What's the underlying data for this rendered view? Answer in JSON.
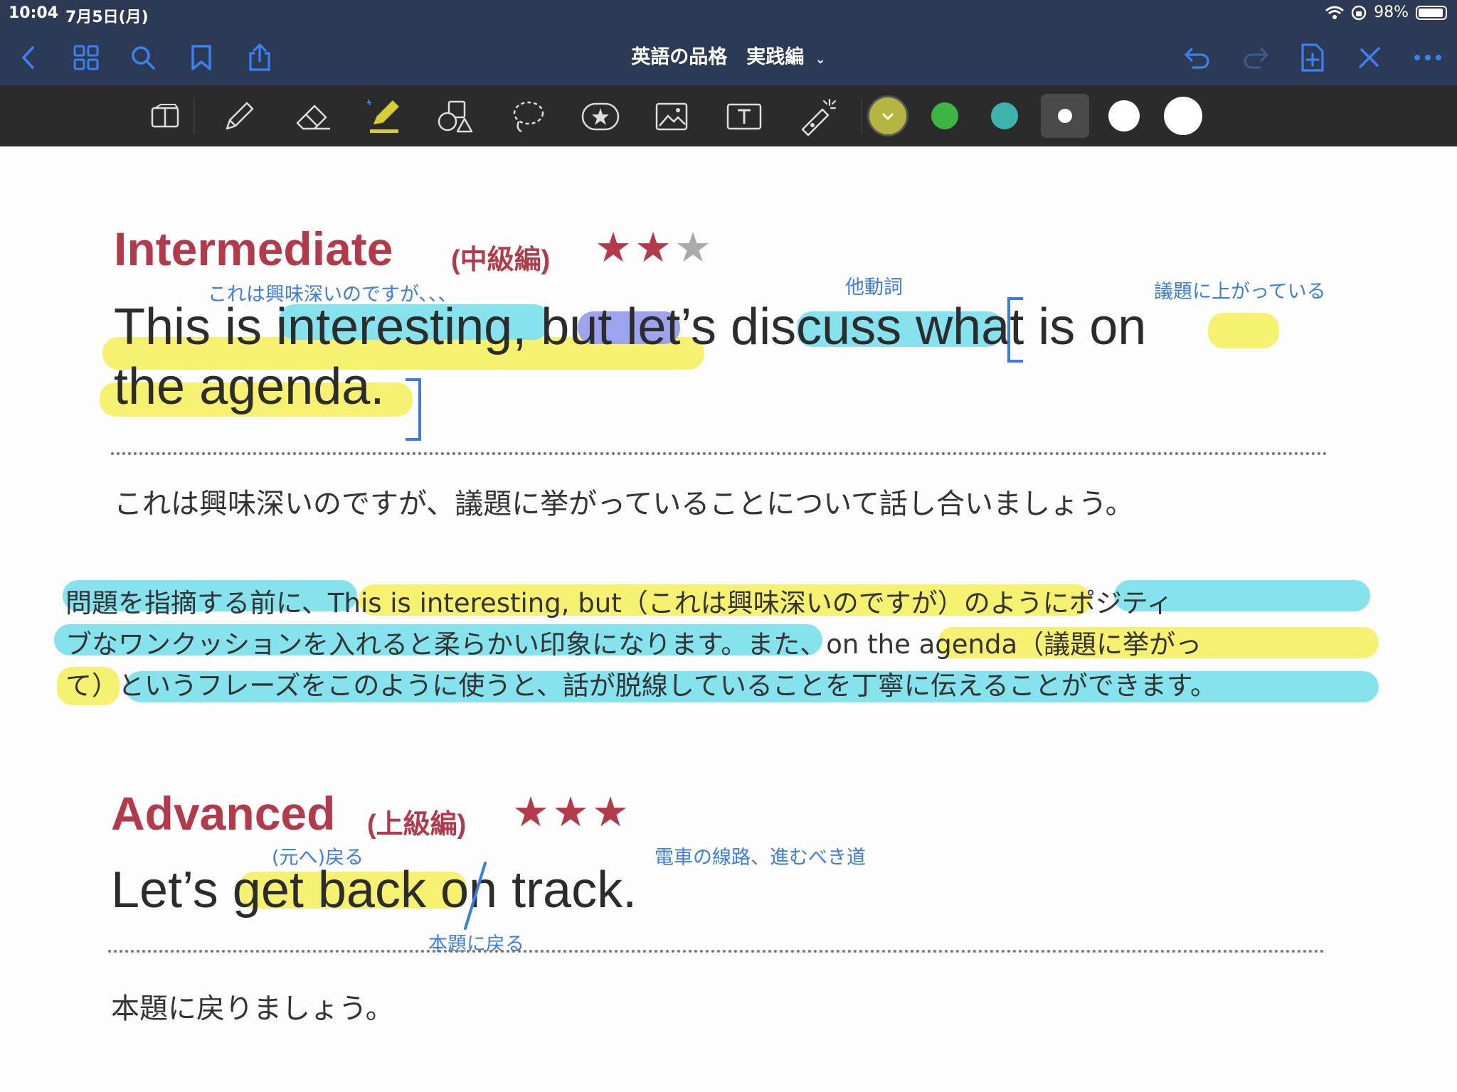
{
  "status_bar": {
    "time": "10:04",
    "date": "7月5日(月)",
    "battery": "98%"
  },
  "nav_bar": {
    "title": "英語の品格　実践編"
  },
  "toolbar": {
    "tools": [
      "page-layout",
      "pen",
      "eraser",
      "highlighter",
      "shapes",
      "lasso",
      "sticker",
      "image",
      "text",
      "laser-pointer"
    ],
    "colors": [
      "#b6b542",
      "#3bb544",
      "#3db3ad"
    ]
  },
  "document": {
    "intermediate": {
      "heading": "Intermediate",
      "subheading": "(中級編)",
      "stars": "★★",
      "star_empty": "★",
      "sentence_line1": "This is interesting, but let’s discuss what is on",
      "sentence_line2": "the agenda.",
      "note_interesting": "これは興味深いのですが、、、",
      "note_discuss": "他動詞",
      "note_on_agenda": "議題に上がっている",
      "translation": "これは興味深いのですが、議題に挙がっていることについて話し合いましょう。",
      "explanation_line1": "問題を指摘する前に、This is interesting, but（これは興味深いのですが）のようにポジティ",
      "explanation_line2": "ブなワンクッションを入れると柔らかい印象になります。また、on the agenda（議題に挙がっ",
      "explanation_line3": "て）というフレーズをこのように使うと、話が脱線していることを丁寧に伝えることができます。"
    },
    "advanced": {
      "heading": "Advanced",
      "subheading": "(上級編)",
      "stars": "★★★",
      "sentence": "Let’s get back on track.",
      "note_get_back": "(元へ)戻る",
      "note_track": "電車の線路、進むべき道",
      "note_back_on_track": "本題に戻る",
      "translation": "本題に戻りましょう。"
    }
  }
}
